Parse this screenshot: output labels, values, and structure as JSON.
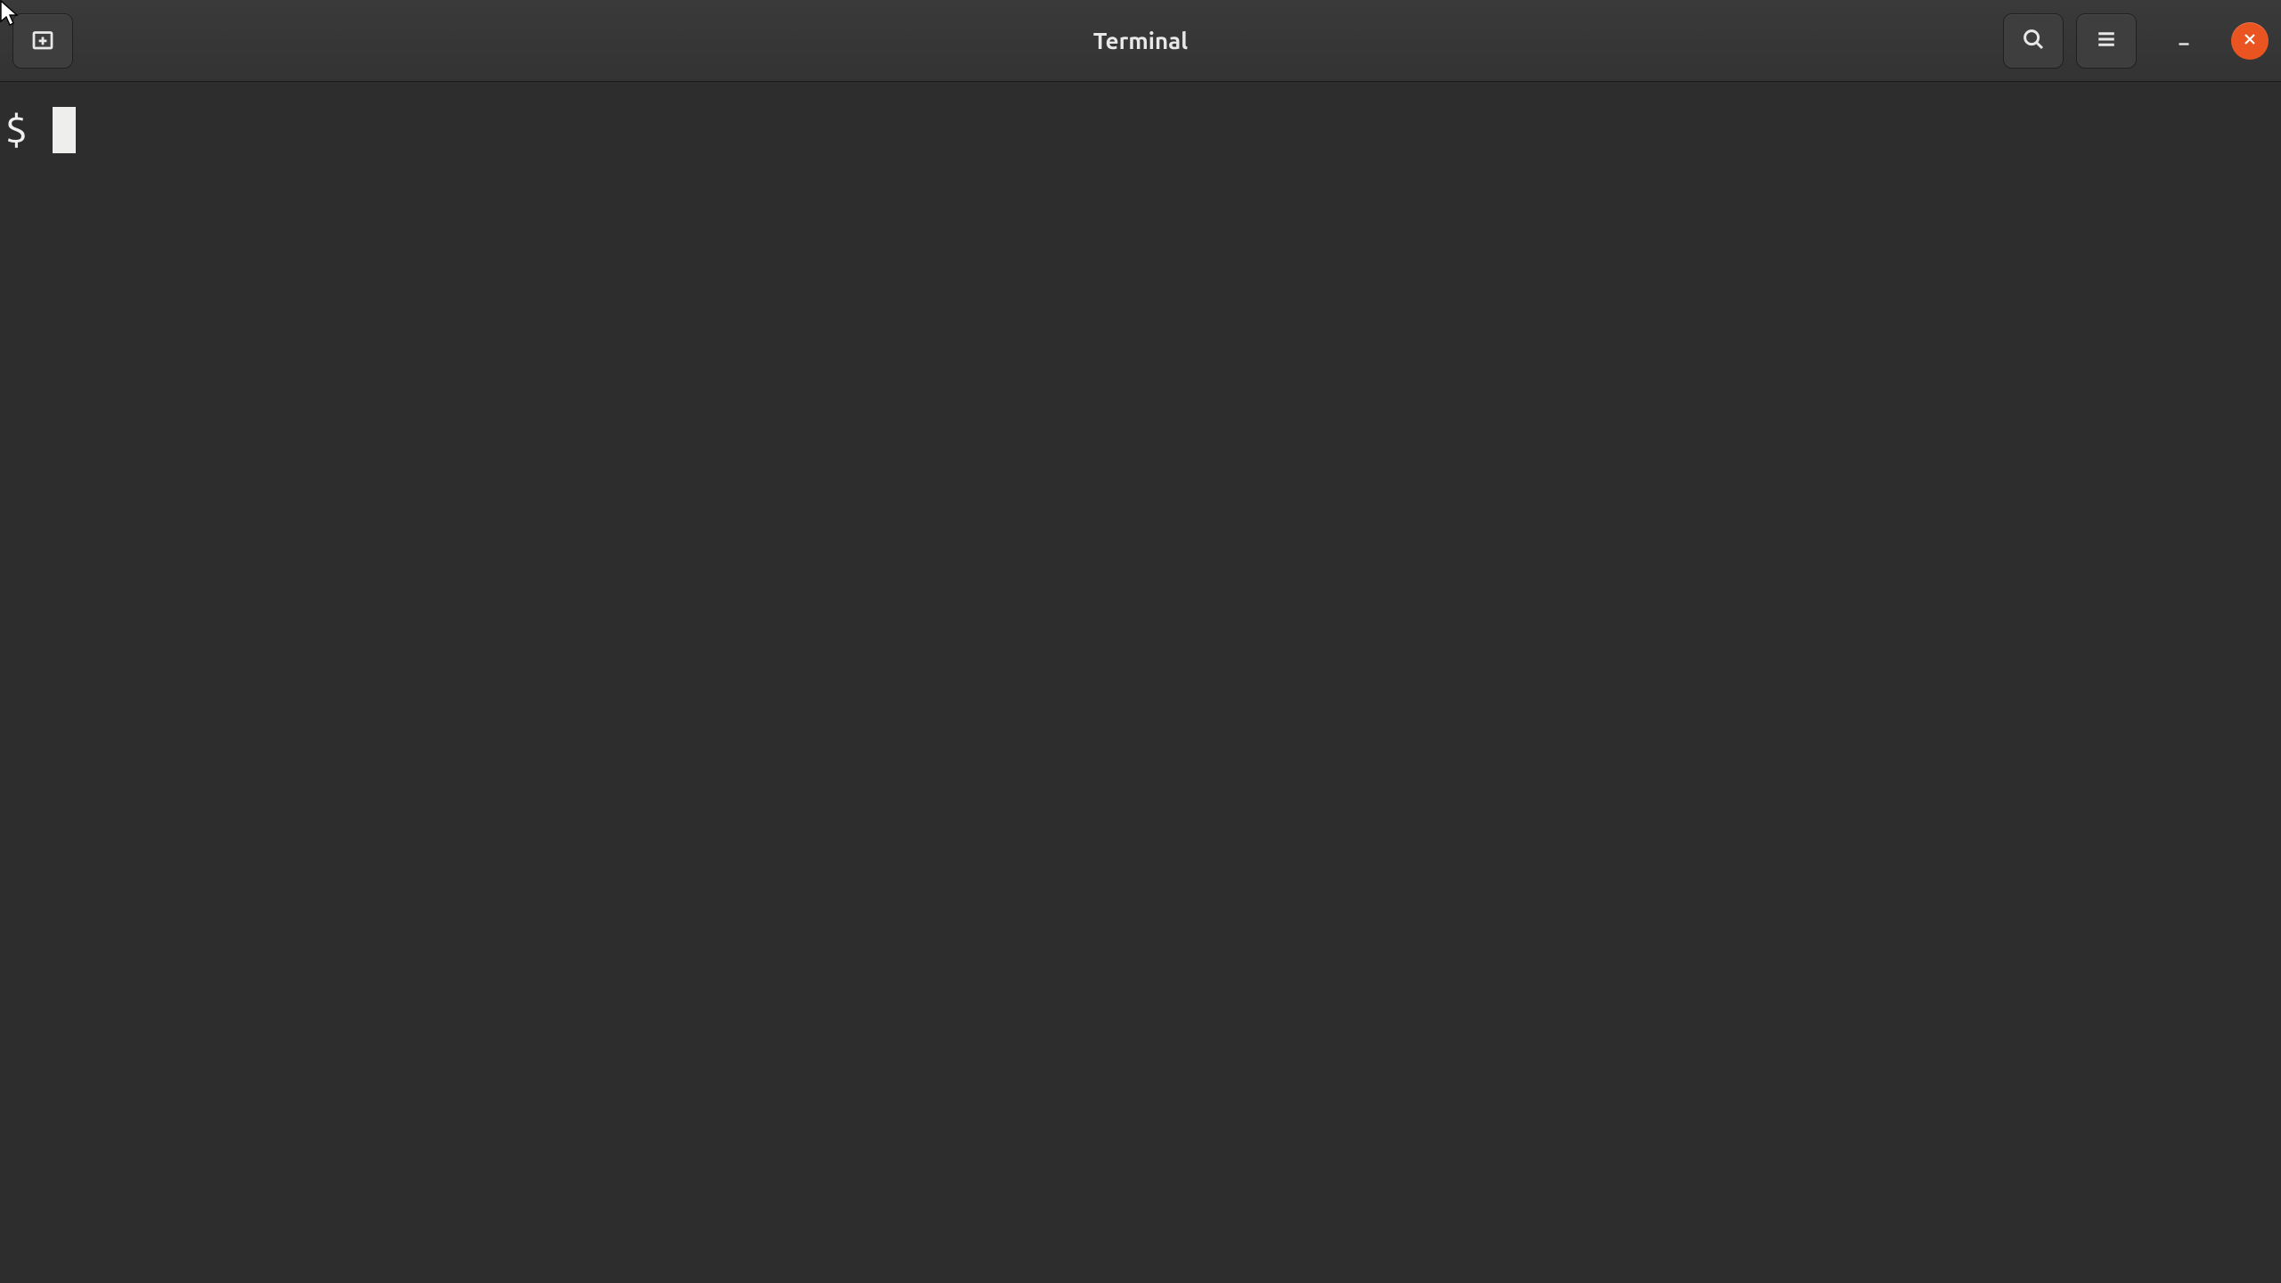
{
  "window": {
    "title": "Terminal"
  },
  "titlebar": {
    "new_tab_label": "New Tab",
    "search_label": "Search",
    "menu_label": "Menu",
    "minimize_label": "Minimize",
    "close_label": "Close"
  },
  "terminal": {
    "prompt": "$ ",
    "input": ""
  },
  "colors": {
    "close_button": "#e95420",
    "background": "#2d2d2d",
    "foreground": "#eeeeec"
  }
}
